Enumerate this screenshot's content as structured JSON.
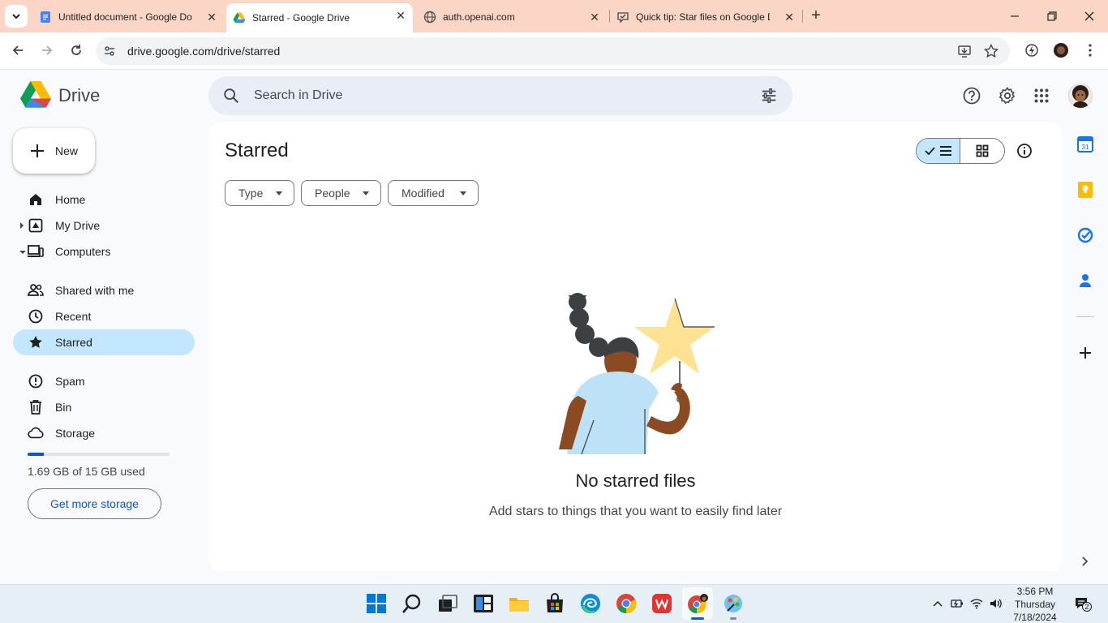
{
  "browser": {
    "tabs": [
      {
        "title": "Untitled document - Google Docs",
        "favicon": "google-docs-icon"
      },
      {
        "title": "Starred - Google Drive",
        "favicon": "google-drive-icon"
      },
      {
        "title": "auth.openai.com",
        "favicon": "globe-icon"
      },
      {
        "title": "Quick tip: Star files on Google Drive",
        "favicon": "tip-icon"
      }
    ],
    "url": "drive.google.com/drive/starred"
  },
  "header": {
    "app_name": "Drive",
    "search_placeholder": "Search in Drive"
  },
  "sidebar": {
    "new_label": "New",
    "items": [
      {
        "label": "Home",
        "icon": "home-icon"
      },
      {
        "label": "My Drive",
        "icon": "my-drive-icon"
      },
      {
        "label": "Computers",
        "icon": "computers-icon"
      },
      {
        "label": "Shared with me",
        "icon": "people-icon"
      },
      {
        "label": "Recent",
        "icon": "clock-icon"
      },
      {
        "label": "Starred",
        "icon": "star-icon",
        "active": true
      },
      {
        "label": "Spam",
        "icon": "spam-icon"
      },
      {
        "label": "Bin",
        "icon": "trash-icon"
      },
      {
        "label": "Storage",
        "icon": "cloud-icon"
      }
    ],
    "storage_used_fraction": 0.113,
    "storage_text": "1.69 GB of 15 GB used",
    "get_storage_label": "Get more storage"
  },
  "main": {
    "title": "Starred",
    "filters": [
      "Type",
      "People",
      "Modified"
    ],
    "empty_title": "No starred files",
    "empty_subtitle": "Add stars to things that you want to easily find later"
  },
  "taskbar": {
    "time": "3:56 PM",
    "day": "Thursday",
    "date": "7/18/2024",
    "notification_count": "2"
  },
  "colors": {
    "tabstrip": "#fbd6c7",
    "active_nav": "#c2e7ff",
    "accent": "#0b57d0",
    "star": "#fde293"
  }
}
